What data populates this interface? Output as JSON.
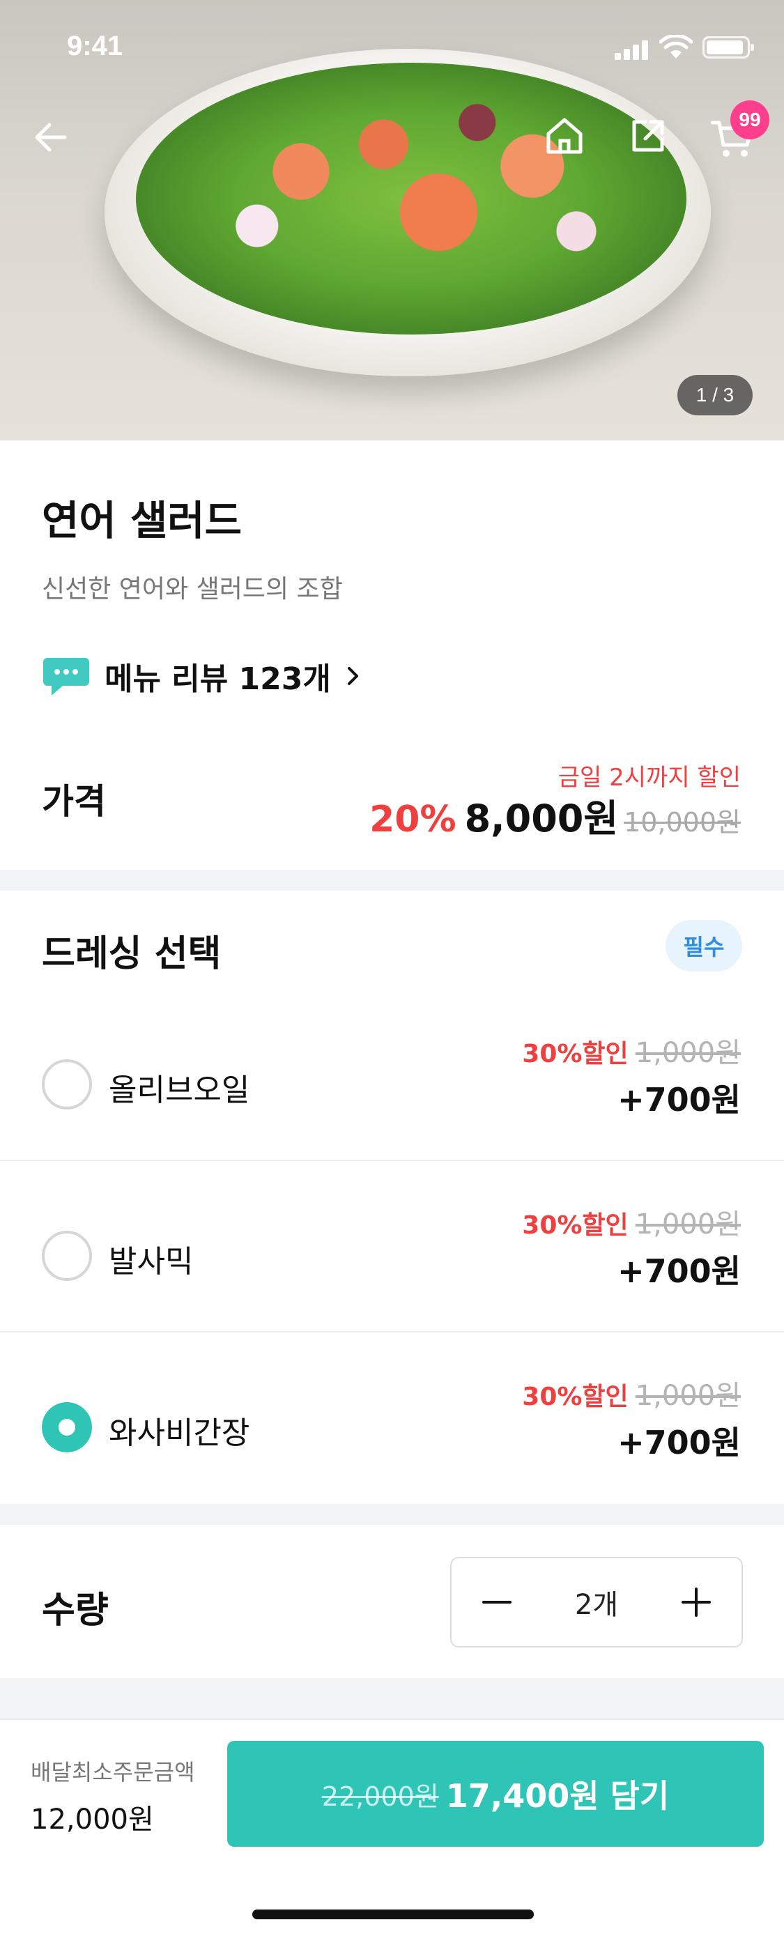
{
  "status_bar": {
    "time": "9:41"
  },
  "header": {
    "cart_count": "99",
    "image_pager": "1 / 3"
  },
  "product": {
    "name": "연어 샐러드",
    "description": "신선한 연어와 샐러드의 조합",
    "review_link": "메뉴 리뷰 123개"
  },
  "price": {
    "label": "가격",
    "promo_note": "금일 2시까지 할인",
    "discount_rate": "20%",
    "sale_price": "8,000원",
    "original_price": "10,000원"
  },
  "dressing": {
    "title": "드레싱 선택",
    "required_badge": "필수",
    "options": [
      {
        "name": "올리브오일",
        "discount": "30%할인",
        "original": "1,000원",
        "price": "+700원",
        "selected": false
      },
      {
        "name": "발사믹",
        "discount": "30%할인",
        "original": "1,000원",
        "price": "+700원",
        "selected": false
      },
      {
        "name": "와사비간장",
        "discount": "30%할인",
        "original": "1,000원",
        "price": "+700원",
        "selected": true
      }
    ]
  },
  "quantity": {
    "label": "수량",
    "value": "2개"
  },
  "bottom_bar": {
    "min_order_label": "배달최소주문금액",
    "min_order_value": "12,000원",
    "cta_original": "22,000원",
    "cta_label": "17,400원 담기"
  },
  "colors": {
    "accent": "#2ec4b6",
    "discount": "#ef3f3f",
    "badge": "#ff3f8e"
  }
}
